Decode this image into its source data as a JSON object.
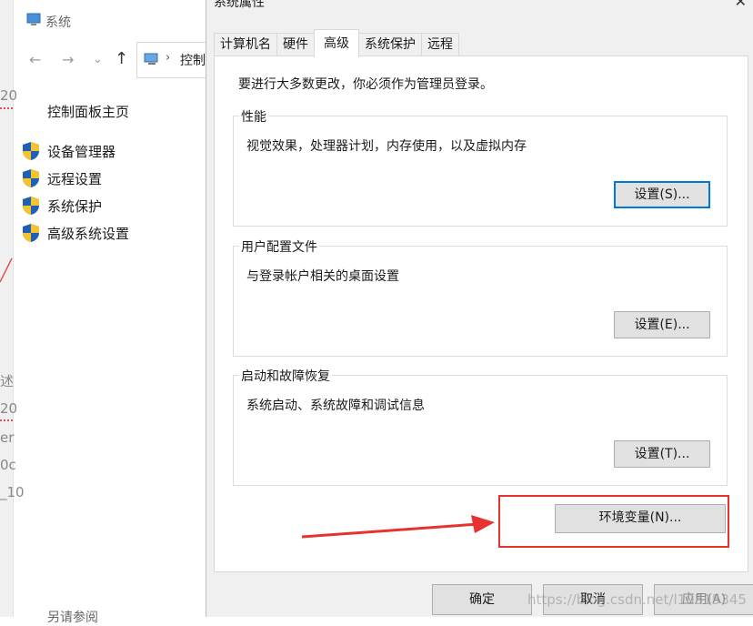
{
  "background_window": {
    "title": "系统",
    "nav": {
      "back": "←",
      "forward": "→",
      "dropdown": "⌄",
      "up": "↑"
    },
    "address": {
      "separator": "›",
      "text": "控制"
    },
    "control_panel_home": "控制面板主页",
    "sidebar_items": [
      {
        "label": "设备管理器",
        "icon": "shield-icon"
      },
      {
        "label": "远程设置",
        "icon": "shield-icon"
      },
      {
        "label": "系统保护",
        "icon": "shield-icon"
      },
      {
        "label": "高级系统设置",
        "icon": "shield-icon"
      }
    ],
    "bottom_cut_text": "另请参阅",
    "left_fragments": [
      "20",
      "述",
      "20",
      "er",
      "0c",
      "_10"
    ]
  },
  "dialog": {
    "title": "系统属性",
    "close_glyph": "✕",
    "tabs": [
      {
        "label": "计算机名",
        "active": false
      },
      {
        "label": "硬件",
        "active": false
      },
      {
        "label": "高级",
        "active": true
      },
      {
        "label": "系统保护",
        "active": false
      },
      {
        "label": "远程",
        "active": false
      }
    ],
    "notice": "要进行大多数更改，你必须作为管理员登录。",
    "groups": {
      "performance": {
        "title": "性能",
        "desc": "视觉效果，处理器计划，内存使用，以及虚拟内存",
        "button": "设置(S)..."
      },
      "user_profiles": {
        "title": "用户配置文件",
        "desc": "与登录帐户相关的桌面设置",
        "button": "设置(E)..."
      },
      "startup_recovery": {
        "title": "启动和故障恢复",
        "desc": "系统启动、系统故障和调试信息",
        "button": "设置(T)..."
      }
    },
    "env_button": "环境变量(N)...",
    "footer": {
      "ok": "确定",
      "cancel": "取消",
      "apply": "应用(A)"
    }
  },
  "watermark": "https://blog.csdn.net/l10515345",
  "colors": {
    "annotation_red": "#e8322f",
    "focus_blue": "#0078d7",
    "dialog_bg": "#f0f0f0"
  }
}
